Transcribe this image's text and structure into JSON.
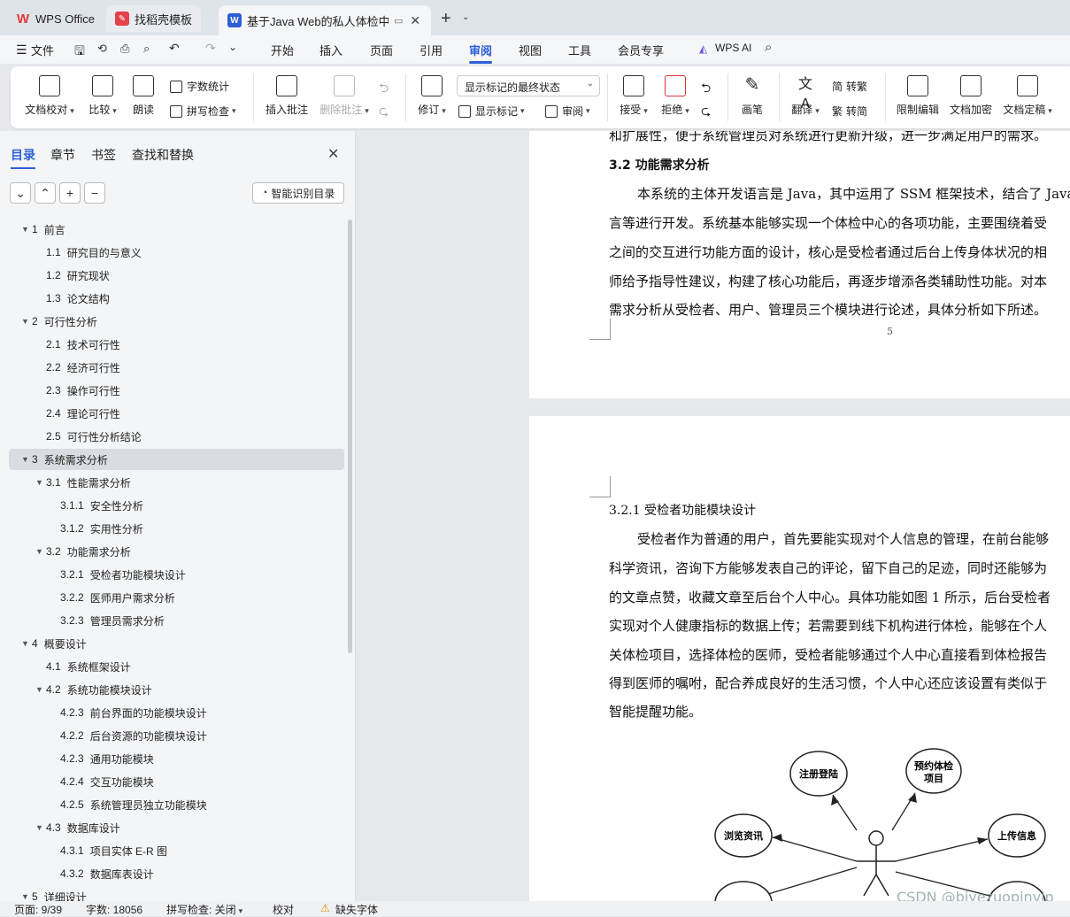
{
  "tabs": {
    "wps_office": "WPS Office",
    "template": "找稻壳模板",
    "document": "基于Java Web的私人体检中心"
  },
  "menu": {
    "file": "文件",
    "items": [
      "开始",
      "插入",
      "页面",
      "引用",
      "审阅",
      "视图",
      "工具",
      "会员专享"
    ],
    "active": "审阅",
    "wps_ai": "WPS AI"
  },
  "ribbon": {
    "doc_check": "文档校对",
    "compare": "比较",
    "read_aloud": "朗读",
    "word_count": "字数统计",
    "spell_check": "拼写检查",
    "insert_comment": "插入批注",
    "delete_comment": "删除批注",
    "track": "修订",
    "markup_dropdown": "显示标记的最终状态",
    "show_markup": "显示标记",
    "review": "审阅",
    "accept": "接受",
    "reject": "拒绝",
    "pen": "画笔",
    "translate": "翻译",
    "to_traditional": "转繁",
    "to_simplified": "转简",
    "restrict_edit": "限制编辑",
    "encrypt": "文档加密",
    "finalize": "文档定稿"
  },
  "sidebar": {
    "tabs": [
      "目录",
      "章节",
      "书签",
      "查找和替换"
    ],
    "smart_toc": "智能识别目录",
    "toc": [
      {
        "num": "1",
        "text": "前言",
        "level": 1,
        "expanded": true
      },
      {
        "num": "1.1",
        "text": "研究目的与意义",
        "level": 2
      },
      {
        "num": "1.2",
        "text": "研究现状",
        "level": 2
      },
      {
        "num": "1.3",
        "text": "论文结构",
        "level": 2
      },
      {
        "num": "2",
        "text": "可行性分析",
        "level": 1,
        "expanded": true
      },
      {
        "num": "2.1",
        "text": "技术可行性",
        "level": 2
      },
      {
        "num": "2.2",
        "text": "经济可行性",
        "level": 2
      },
      {
        "num": "2.3",
        "text": "操作可行性",
        "level": 2
      },
      {
        "num": "2.4",
        "text": "理论可行性",
        "level": 2
      },
      {
        "num": "2.5",
        "text": "可行性分析结论",
        "level": 2
      },
      {
        "num": "3",
        "text": "系统需求分析",
        "level": 1,
        "expanded": true,
        "selected": true
      },
      {
        "num": "3.1",
        "text": "性能需求分析",
        "level": 2,
        "expanded": true
      },
      {
        "num": "3.1.1",
        "text": "安全性分析",
        "level": 3
      },
      {
        "num": "3.1.2",
        "text": "实用性分析",
        "level": 3
      },
      {
        "num": "3.2",
        "text": "功能需求分析",
        "level": 2,
        "expanded": true
      },
      {
        "num": "3.2.1",
        "text": "受检者功能模块设计",
        "level": 3
      },
      {
        "num": "3.2.2",
        "text": "医师用户需求分析",
        "level": 3
      },
      {
        "num": "3.2.3",
        "text": "管理员需求分析",
        "level": 3
      },
      {
        "num": "4",
        "text": "概要设计",
        "level": 1,
        "expanded": true
      },
      {
        "num": "4.1",
        "text": "系统框架设计",
        "level": 2
      },
      {
        "num": "4.2",
        "text": "系统功能模块设计",
        "level": 2,
        "expanded": true
      },
      {
        "num": "4.2.3",
        "text": "前台界面的功能模块设计",
        "level": 3
      },
      {
        "num": "4.2.2",
        "text": "后台资源的功能模块设计",
        "level": 3
      },
      {
        "num": "4.2.3",
        "text": "通用功能模块",
        "level": 3
      },
      {
        "num": "4.2.4",
        "text": "交互功能模块",
        "level": 3
      },
      {
        "num": "4.2.5",
        "text": "系统管理员独立功能模块",
        "level": 3
      },
      {
        "num": "4.3",
        "text": "数据库设计",
        "level": 2,
        "expanded": true
      },
      {
        "num": "4.3.1",
        "text": "项目实体 E-R 图",
        "level": 3
      },
      {
        "num": "4.3.2",
        "text": "数据库表设计",
        "level": 3
      },
      {
        "num": "5",
        "text": "详细设计",
        "level": 1,
        "expanded": true
      }
    ]
  },
  "page1": {
    "lines": [
      "和扩展性，便于系统管理员对系统进行更新升级，进一步满足用户的需求。",
      "本系统的主体开发语言是 Java，其中运用了 SSM 框架技术，结合了 Java",
      "言等进行开发。系统基本能够实现一个体检中心的各项功能，主要围绕着受",
      "之间的交互进行功能方面的设计，核心是受检者通过后台上传身体状况的相",
      "师给予指导性建议，构建了核心功能后，再逐步增添各类辅助性功能。对本",
      "需求分析从受检者、用户、管理员三个模块进行论述，具体分析如下所述。"
    ],
    "heading": "3.2  功能需求分析",
    "page_number": "5"
  },
  "page2": {
    "heading": "3.2.1  受检者功能模块设计",
    "lines": [
      "受检者作为普通的用户，首先要能实现对个人信息的管理，在前台能够",
      "科学资讯，咨询下方能够发表自己的评论，留下自己的足迹，同时还能够为",
      "的文章点赞，收藏文章至后台个人中心。具体功能如图 1 所示，后台受检者",
      "实现对个人健康指标的数据上传；若需要到线下机构进行体检，能够在个人",
      "关体检项目，选择体检的医师，受检者能够通过个人中心直接看到体检报告",
      "得到医师的嘱咐，配合养成良好的生活习惯，个人中心还应该设置有类似于",
      "智能提醒功能。"
    ],
    "diagram": {
      "nodes": [
        "注册登陆",
        "预约体检项目",
        "上传信息",
        "浏览资讯"
      ]
    }
  },
  "watermark": "CSDN @biyezuopinvip",
  "status": {
    "page": "页面: 9/39",
    "words": "字数: 18056",
    "spell": "拼写检查: 关闭",
    "proof": "校对",
    "missing_font": "缺失字体"
  }
}
